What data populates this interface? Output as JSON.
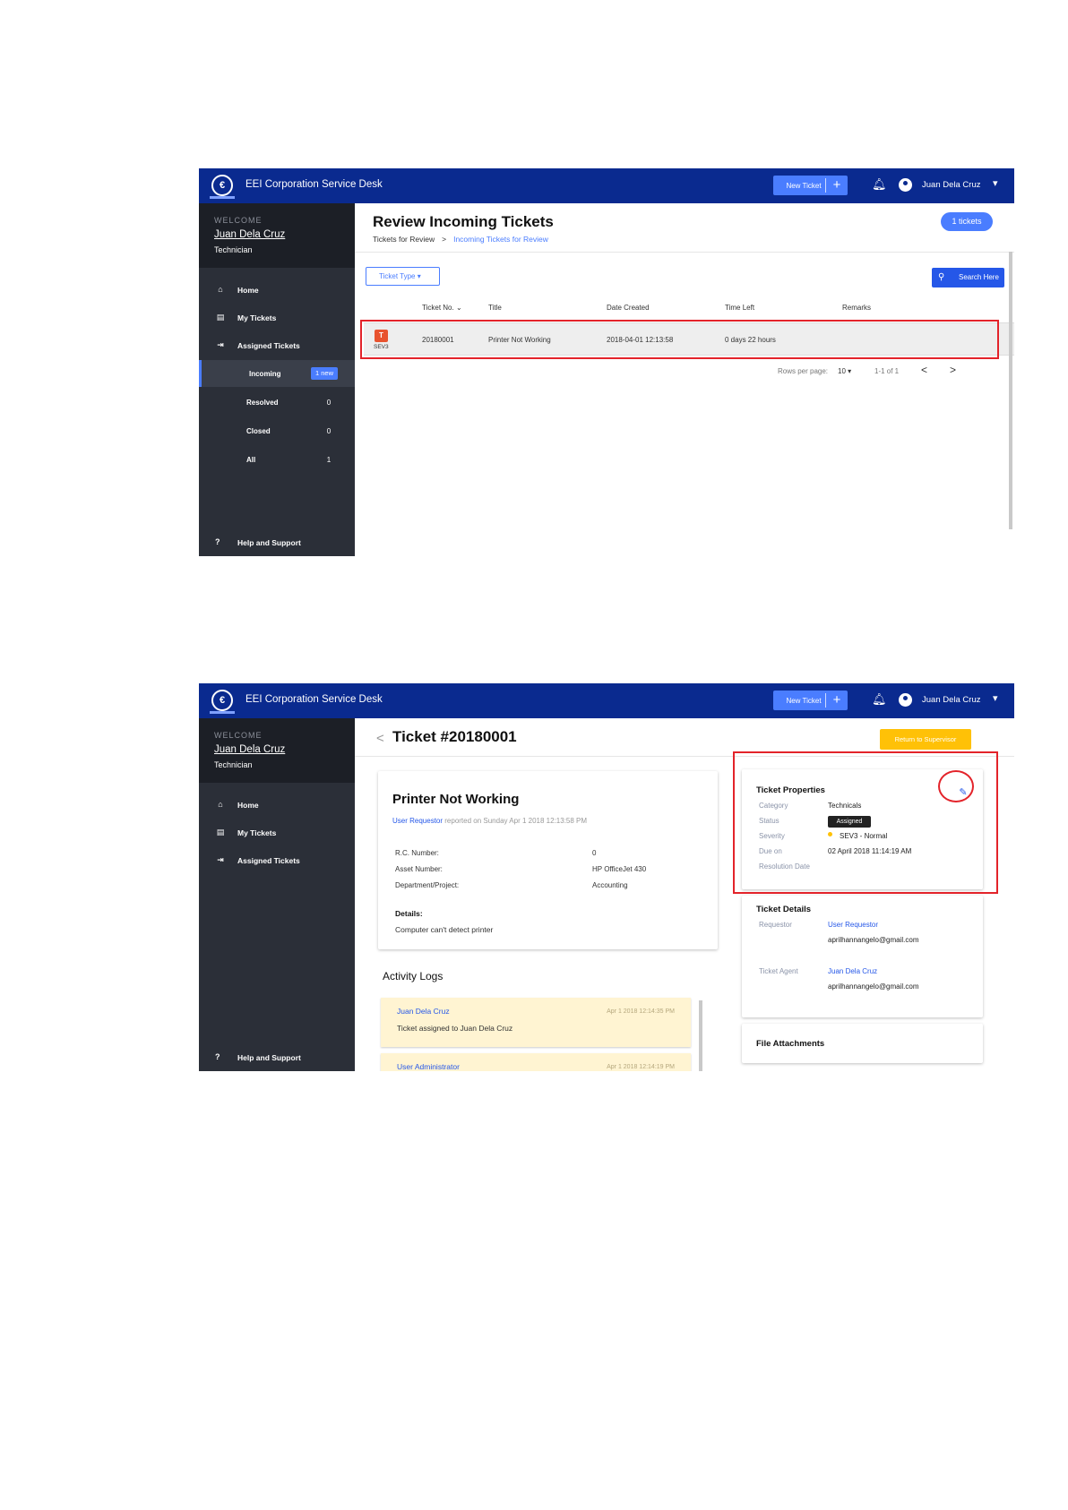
{
  "app": {
    "title": "EEI Corporation Service Desk",
    "logo_text": "€",
    "new_ticket_label": "New Ticket",
    "plus": "+",
    "bell_icon": "bell-icon",
    "user_name": "Juan Dela Cruz",
    "caret": "⌄"
  },
  "sidebar": {
    "welcome_label": "WELCOME",
    "user_name": "Juan Dela Cruz",
    "role": "Technician",
    "nav": [
      {
        "label": "Home",
        "icon": "⌂"
      },
      {
        "label": "My Tickets",
        "icon": "▤"
      },
      {
        "label": "Assigned Tickets",
        "icon": "⇥"
      }
    ],
    "sub": [
      {
        "label": "Incoming",
        "badge": "1 new"
      },
      {
        "label": "Resolved",
        "count": "0"
      },
      {
        "label": "Closed",
        "count": "0"
      },
      {
        "label": "All",
        "count": "1"
      }
    ],
    "help_label": "Help and Support",
    "help_icon": "?"
  },
  "review": {
    "title": "Review Incoming Tickets",
    "breadcrumb_root": "Tickets for Review",
    "breadcrumb_sep": ">",
    "breadcrumb_current": "Incoming Tickets for Review",
    "tickets_pill": "1 tickets",
    "ticket_type_label": "Ticket Type",
    "search_label": "Search Here",
    "columns": [
      "Ticket No.",
      "Title",
      "Date Created",
      "Time Left",
      "Remarks"
    ],
    "row": {
      "type_letter": "T",
      "severity": "SEV3",
      "ticket_no": "20180001",
      "title": "Printer Not Working",
      "date_created": "2018-04-01 12:13:58",
      "time_left": "0 days 22 hours",
      "remarks": ""
    },
    "pagination": {
      "rows_per_page_label": "Rows per page:",
      "rows_per_page": "10",
      "range": "1-1 of 1",
      "prev": "<",
      "next": ">"
    }
  },
  "detail": {
    "back": "<",
    "title": "Ticket #20180001",
    "return_label": "Return to Supervisor",
    "card": {
      "title": "Printer Not Working",
      "requestor_link": "User Requestor",
      "reported_text": " reported on Sunday Apr 1 2018 12:13:58 PM",
      "fields": [
        {
          "label": "R.C. Number:",
          "value": "0"
        },
        {
          "label": "Asset Number:",
          "value": "HP OfficeJet 430"
        },
        {
          "label": "Department/Project:",
          "value": "Accounting"
        }
      ],
      "details_label": "Details:",
      "details_value": "Computer can't detect printer"
    },
    "activity_title": "Activity Logs",
    "logs": [
      {
        "user": "Juan Dela Cruz",
        "time": "Apr 1 2018 12:14:35 PM",
        "message": "Ticket assigned to Juan Dela Cruz"
      },
      {
        "user": "User Administrator",
        "time": "Apr 1 2018 12:14:19 PM",
        "message": ""
      }
    ],
    "properties": {
      "title": "Ticket Properties",
      "category_label": "Category",
      "category": "Technicals",
      "status_label": "Status",
      "status": "Assigned",
      "severity_label": "Severity",
      "severity": "SEV3 - Normal",
      "due_label": "Due on",
      "due": "02 April 2018 11:14:19 AM",
      "resolution_label": "Resolution Date",
      "resolution": "",
      "edit_icon": "✎"
    },
    "ticket_details": {
      "title": "Ticket Details",
      "requestor_label": "Requestor",
      "requestor_name": "User Requestor",
      "requestor_email": "aprilhannangelo@gmail.com",
      "agent_label": "Ticket Agent",
      "agent_name": "Juan Dela Cruz",
      "agent_email": "aprilhannangelo@gmail.com"
    },
    "attachments_title": "File Attachments"
  },
  "colors": {
    "topbar": "#0a2a8f",
    "sidebar": "#2b2f38",
    "accent": "#4a7dff",
    "highlight": "#e3232a",
    "warning": "#ffc107"
  }
}
